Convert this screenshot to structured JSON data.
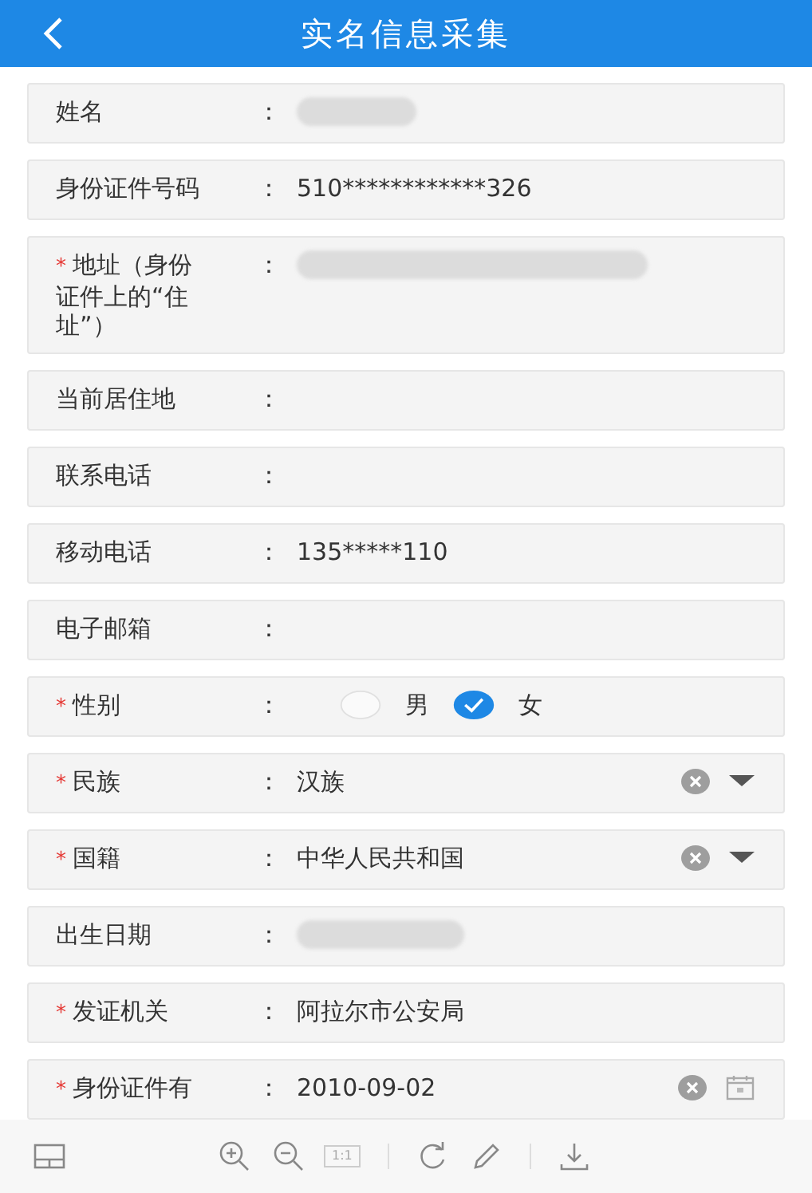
{
  "header": {
    "title": "实名信息采集"
  },
  "fields": [
    {
      "kind": "redacted",
      "label": "姓名",
      "colon": "："
    },
    {
      "kind": "text",
      "label": "身份证件号码",
      "colon": "：",
      "value": "510************326"
    },
    {
      "kind": "redacted",
      "label": "地址（身份证件上的“住址”）",
      "required_mark": "*",
      "colon": "："
    },
    {
      "kind": "text",
      "label": "当前居住地",
      "colon": "："
    },
    {
      "kind": "text",
      "label": "联系电话",
      "colon": "："
    },
    {
      "kind": "text",
      "label": "移动电话",
      "colon": "：",
      "value": "135*****110"
    },
    {
      "kind": "text",
      "label": "电子邮箱",
      "colon": "："
    },
    {
      "kind": "radio",
      "label": "性别",
      "required_mark": "*",
      "colon": "：",
      "options": [
        {
          "label": "男",
          "selected": false
        },
        {
          "label": "女",
          "selected": true
        }
      ]
    },
    {
      "kind": "select",
      "label": "民族",
      "required_mark": "*",
      "colon": "：",
      "value": "汉族"
    },
    {
      "kind": "select",
      "label": "国籍",
      "required_mark": "*",
      "colon": "：",
      "value": "中华人民共和国"
    },
    {
      "kind": "redacted",
      "label": "出生日期",
      "colon": "："
    },
    {
      "kind": "text",
      "label": "发证机关",
      "required_mark": "*",
      "colon": "：",
      "value": "阿拉尔市公安局"
    },
    {
      "kind": "date",
      "label": "身份证件有",
      "required_mark": "*",
      "colon": "：",
      "value": "2010-09-02"
    }
  ],
  "toolbar": {
    "actual_size_label": "1:1"
  }
}
